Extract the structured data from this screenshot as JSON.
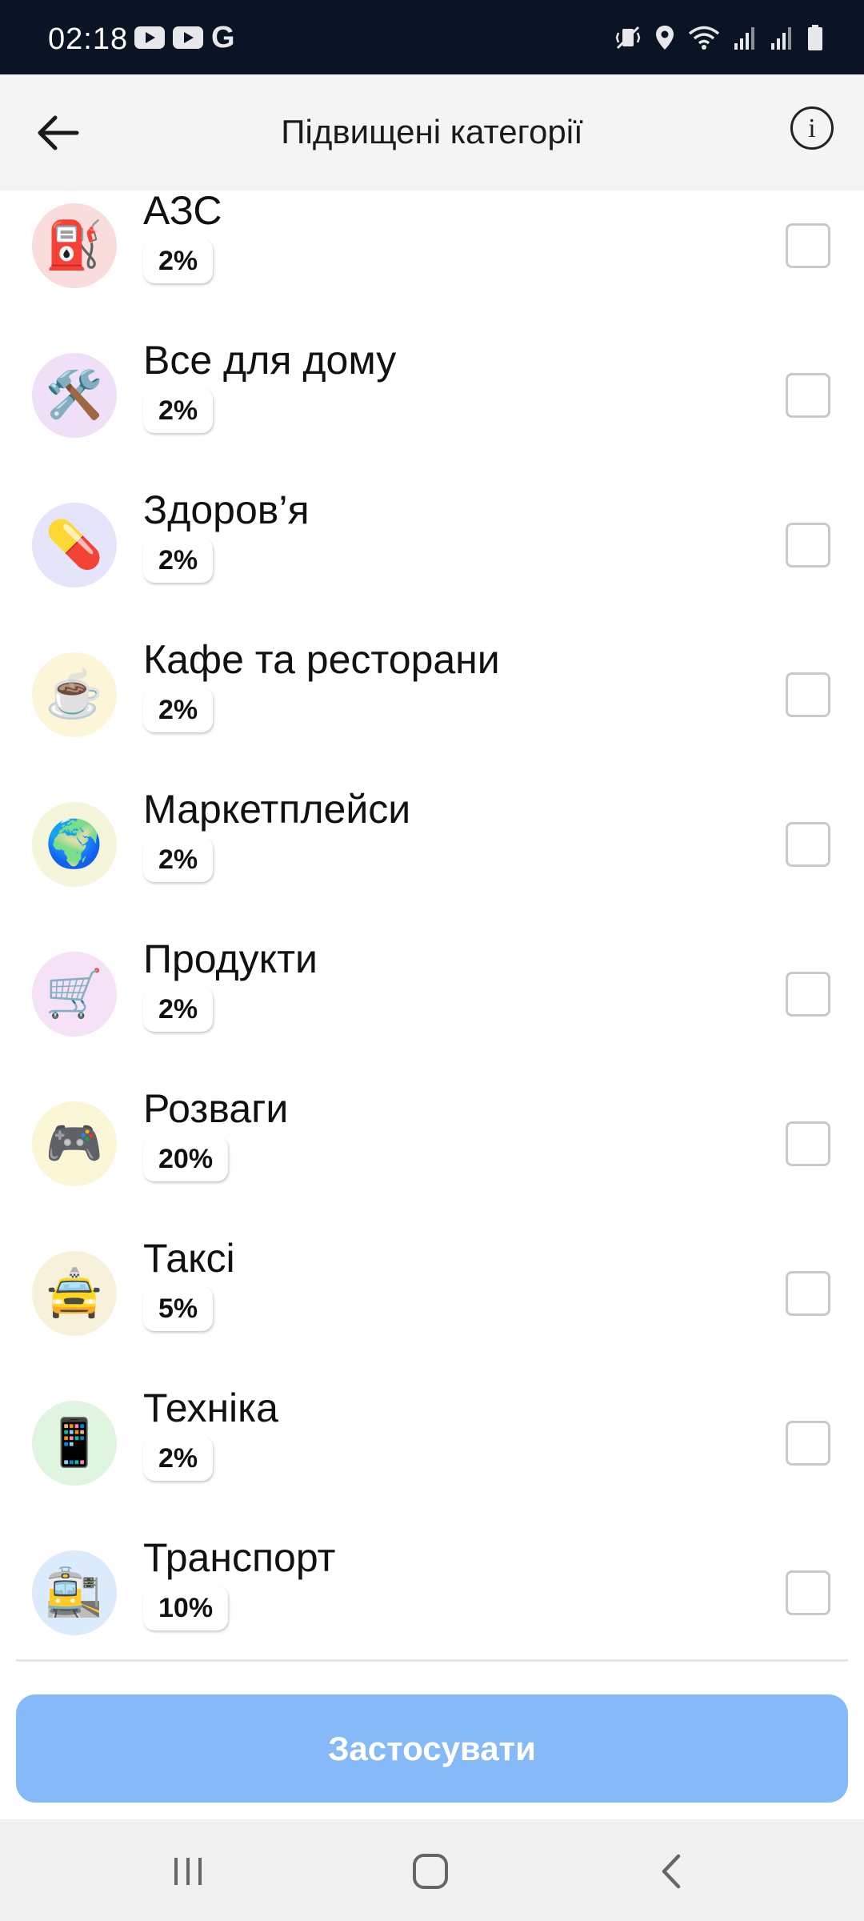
{
  "status_bar": {
    "time": "02:18",
    "left_icons": [
      "youtube-icon",
      "youtube-icon",
      "google-icon"
    ],
    "google_glyph": "G",
    "right_icons": [
      "vibrate-icon",
      "location-icon",
      "wifi-icon",
      "signal-icon",
      "signal-icon",
      "battery-icon"
    ]
  },
  "header": {
    "title": "Підвищені категорії",
    "back_icon": "arrow-left-icon",
    "info_glyph": "i"
  },
  "categories": [
    {
      "name": "АЗС",
      "cashback": "2%",
      "icon": "⛽",
      "icon_bg": "#f9dddd",
      "checked": false
    },
    {
      "name": "Все для дому",
      "cashback": "2%",
      "icon": "🛠️",
      "icon_bg": "#efe0f8",
      "checked": false
    },
    {
      "name": "Здоров’я",
      "cashback": "2%",
      "icon": "💊",
      "icon_bg": "#e4e4fb",
      "checked": false
    },
    {
      "name": "Кафе та ресторани",
      "cashback": "2%",
      "icon": "☕",
      "icon_bg": "#fdf5d8",
      "checked": false
    },
    {
      "name": "Маркетплейси",
      "cashback": "2%",
      "icon": "🌍",
      "icon_bg": "#f5f5dc",
      "checked": false
    },
    {
      "name": "Продукти",
      "cashback": "2%",
      "icon": "🛒",
      "icon_bg": "#f6e2f7",
      "checked": false
    },
    {
      "name": "Розваги",
      "cashback": "20%",
      "icon": "🎮",
      "icon_bg": "#fbf6d6",
      "checked": false
    },
    {
      "name": "Таксі",
      "cashback": "5%",
      "icon": "🚖",
      "icon_bg": "#f7f1dc",
      "checked": false
    },
    {
      "name": "Техніка",
      "cashback": "2%",
      "icon": "📱",
      "icon_bg": "#dff5df",
      "checked": false
    },
    {
      "name": "Транспорт",
      "cashback": "10%",
      "icon": "🚉",
      "icon_bg": "#dcebfb",
      "checked": false
    }
  ],
  "apply_button": {
    "label": "Застосувати",
    "color": "#85b9f7",
    "enabled": false
  },
  "nav_bar": {
    "icons": [
      "recents-icon",
      "home-icon",
      "back-icon"
    ]
  },
  "colors": {
    "status_bar": "#0b1424",
    "header_bg": "#f4f4f4",
    "nav_bg": "#f1f1f1",
    "checkbox_border": "#c9c9c9"
  }
}
